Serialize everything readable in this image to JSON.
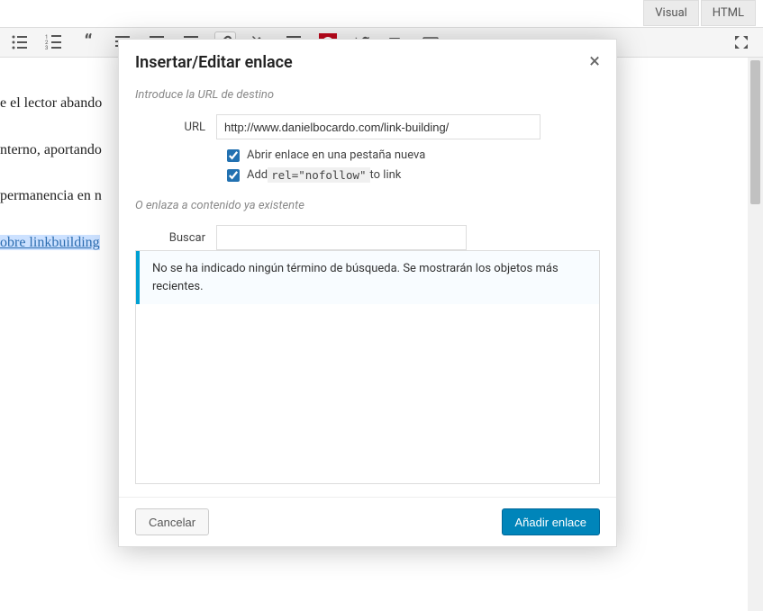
{
  "tabs": {
    "visual": "Visual",
    "html": "HTML"
  },
  "toolbar": {
    "icons": [
      "bullet-list",
      "numbered-list",
      "blockquote",
      "align-left",
      "align-center",
      "align-right",
      "link",
      "unlink",
      "more",
      "image",
      "twitter",
      "video",
      "keyboard",
      "distract"
    ]
  },
  "editor": {
    "line1": "e el lector abando",
    "line2": "",
    "line3": "nterno, aportando",
    "line4": "permanencia en n",
    "link_text": "obre linkbuilding"
  },
  "modal": {
    "title": "Insertar/Editar enlace",
    "close": "×",
    "intro": "Introduce la URL de destino",
    "url_label": "URL",
    "url_value": "http://www.danielbocardo.com/link-building/",
    "checkbox_newtab": "Abrir enlace en una pestaña nueva",
    "checkbox_add_pre": "Add ",
    "checkbox_add_code": "rel=\"nofollow\"",
    "checkbox_add_post": " to link",
    "or_existing": "O enlaza a contenido ya existente",
    "search_label": "Buscar",
    "results_notice": "No se ha indicado ningún término de búsqueda. Se mostrarán los objetos más recientes.",
    "cancel": "Cancelar",
    "submit": "Añadir enlace"
  }
}
